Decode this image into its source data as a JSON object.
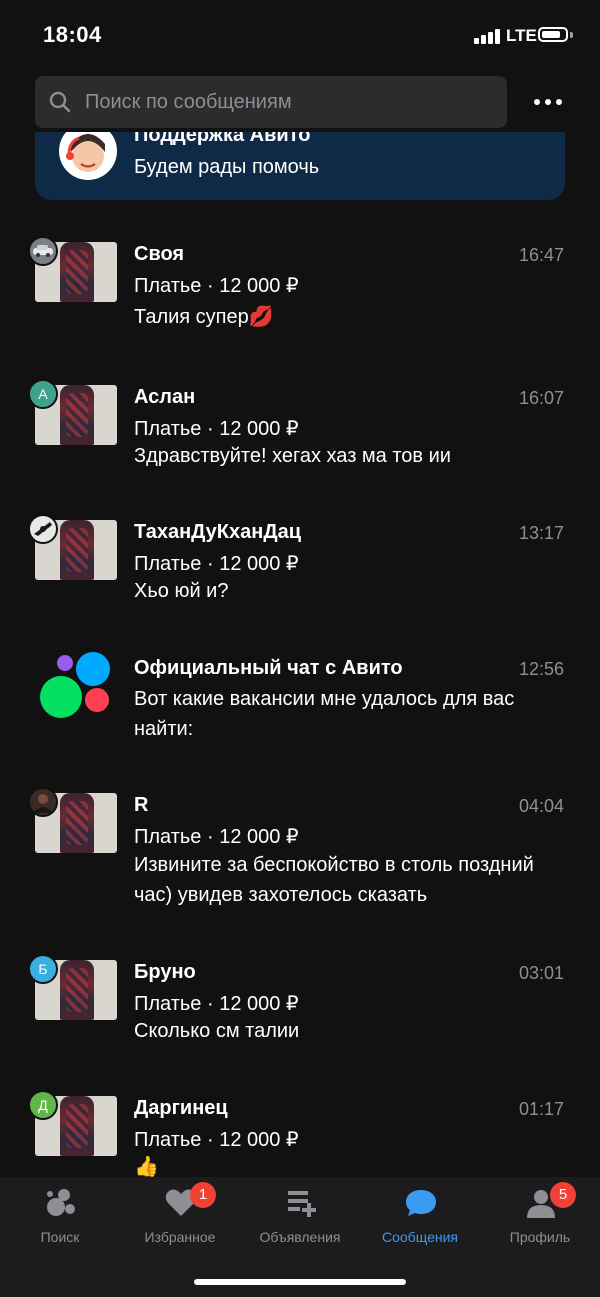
{
  "status_bar": {
    "time": "18:04",
    "network": "LTE"
  },
  "search": {
    "placeholder": "Поиск по сообщениям"
  },
  "support": {
    "title": "Поддержка Авито",
    "subtitle": "Будем рады помочь"
  },
  "chats": [
    {
      "name": "Своя",
      "time": "16:47",
      "ad": "Платье · 12 000 ₽",
      "message": "Талия супер💋",
      "badge_letter": "",
      "badge_color": "#7b7f86"
    },
    {
      "name": "Аслан",
      "time": "16:07",
      "ad": "Платье · 12 000 ₽",
      "message": "Здравствуйте! хегах хаз ма тов ии",
      "badge_letter": "А",
      "badge_color": "#3fa28c"
    },
    {
      "name": "ТаханДуКханДац",
      "time": "13:17",
      "ad": "Платье · 12 000 ₽",
      "message": "Хьо юй и?",
      "badge_letter": "",
      "badge_color": "#2a2a2a"
    },
    {
      "name": "Официальный чат с Авито",
      "time": "12:56",
      "ad": "",
      "message": "Вот какие вакансии мне удалось для вас найти:",
      "badge_letter": "",
      "badge_color": ""
    },
    {
      "name": "R",
      "time": "04:04",
      "ad": "Платье · 12 000 ₽",
      "message": "Извините за беспокойство в столь поздний час) увидев захотелось сказать",
      "badge_letter": "",
      "badge_color": "#3b2a28"
    },
    {
      "name": "Бруно",
      "time": "03:01",
      "ad": "Платье · 12 000 ₽",
      "message": "Сколько см талии",
      "badge_letter": "Б",
      "badge_color": "#3aaede"
    },
    {
      "name": "Даргинец",
      "time": "01:17",
      "ad": "Платье · 12 000 ₽",
      "message": "👍",
      "badge_letter": "Д",
      "badge_color": "#5fb64b"
    }
  ],
  "tabs": [
    {
      "label": "Поиск",
      "icon": "search-tab-icon",
      "badge": ""
    },
    {
      "label": "Избранное",
      "icon": "heart-icon",
      "badge": "1"
    },
    {
      "label": "Объявления",
      "icon": "add-listing-icon",
      "badge": ""
    },
    {
      "label": "Сообщения",
      "icon": "chat-bubble-icon",
      "badge": "",
      "active": true
    },
    {
      "label": "Профиль",
      "icon": "profile-icon",
      "badge": "5"
    }
  ],
  "colors": {
    "background": "#111112",
    "accent": "#3a9bf0",
    "badge_red": "#ef4136",
    "support_bg": "#0f2a47"
  }
}
